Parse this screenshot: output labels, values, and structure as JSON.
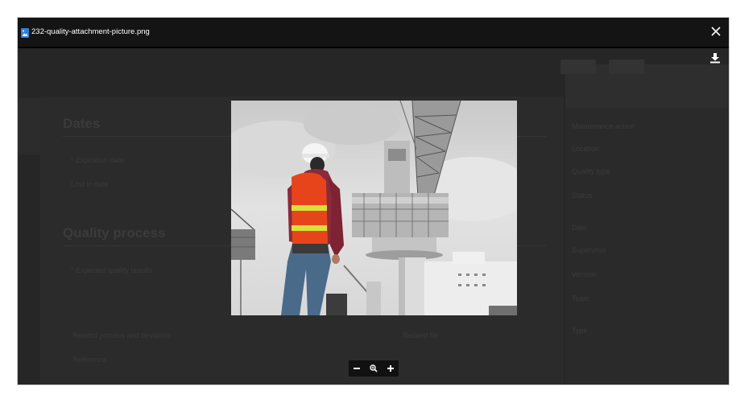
{
  "modal": {
    "file_name": "232-quality-attachment-picture.png",
    "close_icon": "close-icon",
    "download_icon": "download-icon",
    "file_icon": "image-file-icon"
  },
  "zoom_controls": {
    "zoom_out_icon": "minus-icon",
    "zoom_reset_icon": "zoom-icon",
    "zoom_in_icon": "plus-icon"
  },
  "background": {
    "section_dates": "Dates",
    "section_quality": "Quality process",
    "date_field_1": "* Expiration date",
    "date_field_2": "Lost in date",
    "quality_field": "* Expected quality results",
    "bottom_label_1": "Related process and deviation",
    "bottom_label_2": "Related file",
    "bottom_left": "Reference",
    "right_values": [
      "Maintenance action",
      "Location",
      "Quality type",
      "Status",
      "Date",
      "Supervisor",
      "Version",
      "Team",
      "Type"
    ]
  },
  "colors": {
    "overlay": "#262626",
    "header": "#141414",
    "accent_icon": "#2f7fd6"
  }
}
